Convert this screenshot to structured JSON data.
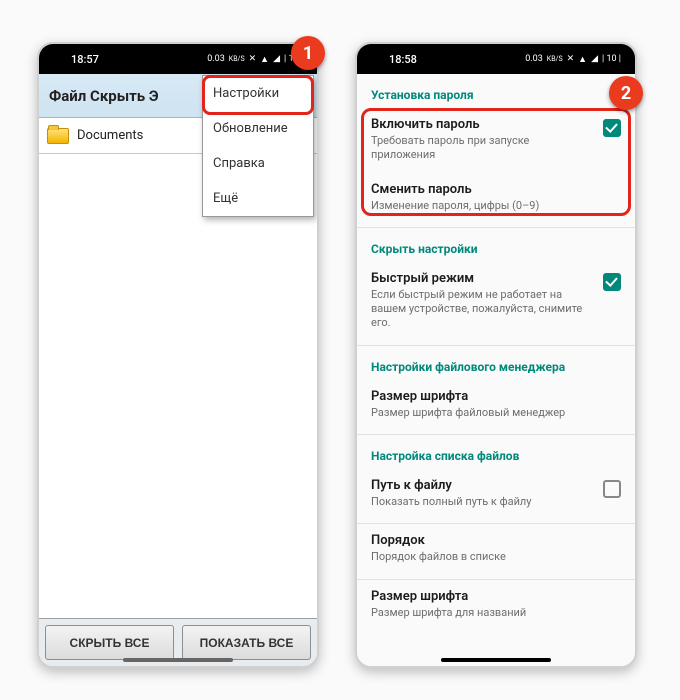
{
  "badges": {
    "one": "1",
    "two": "2"
  },
  "status": {
    "time_left": "18:57",
    "time_right": "18:58",
    "kbps_val": "0.03",
    "kbps_unit": "KB/S",
    "battery": "10"
  },
  "phone1": {
    "title": "Файл Скрыть Э",
    "folder": "Documents",
    "menu": {
      "settings": "Настройки",
      "update": "Обновление",
      "help": "Справка",
      "more": "Ещё"
    },
    "btn_hide": "СКРЫТЬ ВСЕ",
    "btn_show": "ПОКАЗАТЬ ВСЕ"
  },
  "phone2": {
    "sec_password": "Установка пароля",
    "enable_password_title": "Включить пароль",
    "enable_password_sub": "Требовать пароль при запуске приложения",
    "change_password_title": "Сменить пароль",
    "change_password_sub": "Изменение пароля, цифры (0–9)",
    "sec_hide": "Скрыть настройки",
    "fast_mode_title": "Быстрый режим",
    "fast_mode_sub": "Если быстрый режим не работает на вашем устройстве, пожалуйста, снимите его.",
    "sec_fm": "Настройки файлового менеджера",
    "font_size_title": "Размер шрифта",
    "font_size_sub": "Размер шрифта файловый менеджер",
    "sec_list": "Настройка списка файлов",
    "path_title": "Путь к файлу",
    "path_sub": "Показать полный путь к файлу",
    "order_title": "Порядок",
    "order_sub": "Порядок файлов в списке",
    "font_size2_title": "Размер шрифта",
    "font_size2_sub": "Размер шрифта для названий"
  }
}
